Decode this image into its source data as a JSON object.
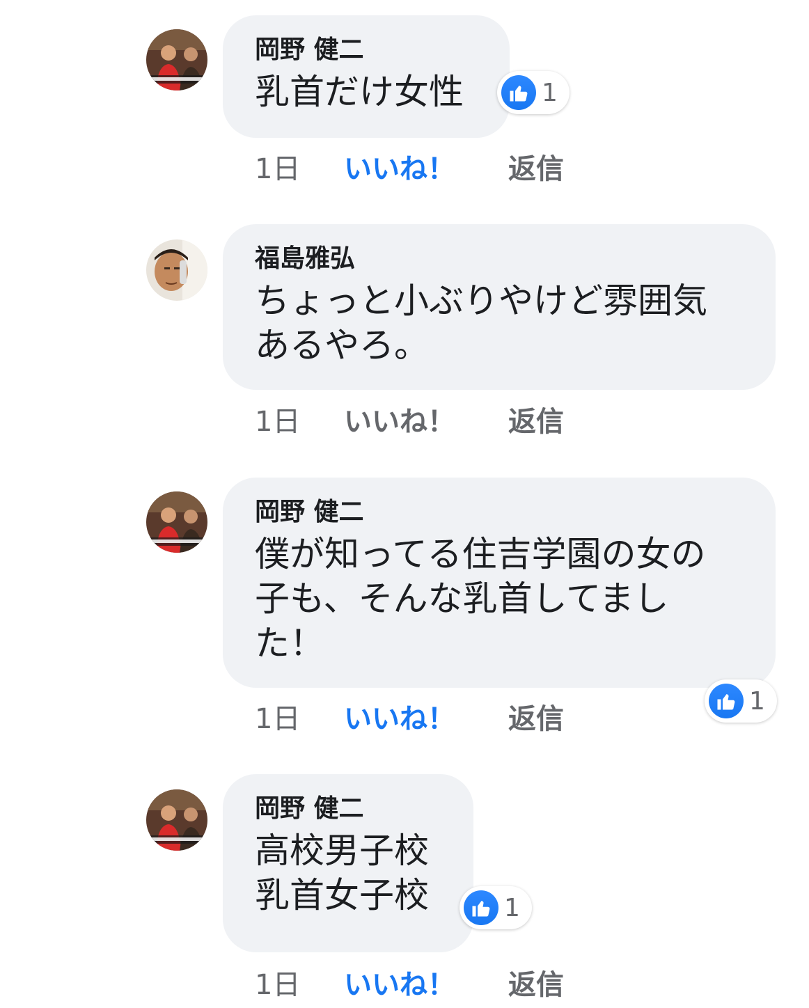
{
  "comments": [
    {
      "author": "岡野 健二",
      "text": "乳首だけ女性",
      "time": "1日",
      "like_label": "いいね！",
      "reply_label": "返信",
      "liked": true,
      "reaction_count": "1",
      "avatar": "photo-red-shirt-men-icon"
    },
    {
      "author": "福島雅弘",
      "text": "ちょっと小ぶりやけど雰囲気\nあるやろ。",
      "time": "1日",
      "like_label": "いいね！",
      "reply_label": "返信",
      "liked": false,
      "avatar": "photo-man-face-icon"
    },
    {
      "author": "岡野 健二",
      "text": "僕が知ってる住吉学園の女の\n子も、そんな乳首してまし\nた！",
      "time": "1日",
      "like_label": "いいね！",
      "reply_label": "返信",
      "liked": true,
      "reaction_count": "1",
      "avatar": "photo-red-shirt-men-icon"
    },
    {
      "author": "岡野 健二",
      "text": "高校男子校\n乳首女子校",
      "time": "1日",
      "like_label": "いいね！",
      "reply_label": "返信",
      "liked": true,
      "reaction_count": "1",
      "avatar": "photo-red-shirt-men-icon"
    }
  ],
  "colors": {
    "bubble_bg": "#f0f2f5",
    "like_blue": "#1877f2",
    "meta_gray": "#65676b"
  }
}
